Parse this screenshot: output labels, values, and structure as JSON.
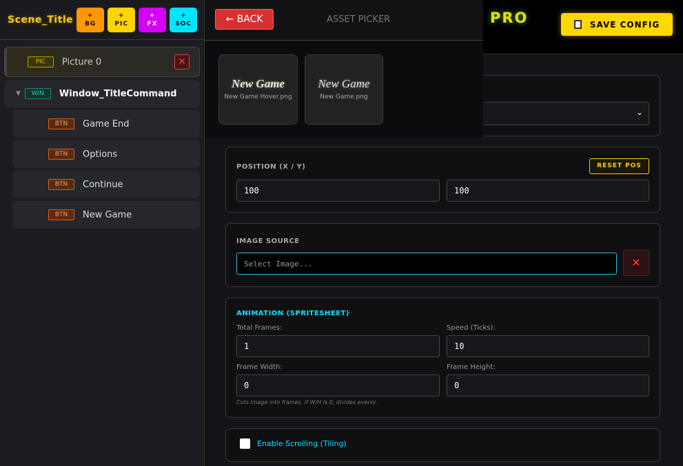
{
  "sidebar": {
    "scene_title": "Scene_Title",
    "add_buttons": [
      {
        "plus": "+",
        "label": "BG",
        "color": "#ff9800"
      },
      {
        "plus": "+",
        "label": "PIC",
        "color": "#ffd500"
      },
      {
        "plus": "+",
        "label": "FX",
        "color": "#d500f9"
      },
      {
        "plus": "+",
        "label": "SOC",
        "color": "#00e5ff"
      }
    ],
    "tree": {
      "picture": {
        "tag": "PIC",
        "label": "Picture 0"
      },
      "window": {
        "tag": "WIN",
        "label": "Window_TitleCommand"
      },
      "buttons": [
        {
          "tag": "BTN",
          "label": "Game End"
        },
        {
          "tag": "BTN",
          "label": "Options"
        },
        {
          "tag": "BTN",
          "label": "Continue"
        },
        {
          "tag": "BTN",
          "label": "New Game"
        }
      ]
    }
  },
  "picker": {
    "back_label": "← BACK",
    "title": "ASSET PICKER",
    "assets": [
      {
        "preview": "New Game",
        "filename": "New Game Hover.png"
      },
      {
        "preview": "New Game",
        "filename": "New Game.png"
      }
    ]
  },
  "header": {
    "pro": "PRO",
    "save_label": "SAVE CONFIG"
  },
  "position": {
    "label": "POSITION (X / Y)",
    "reset_label": "RESET POS",
    "x": "100",
    "y": "100"
  },
  "image_source": {
    "label": "IMAGE SOURCE",
    "placeholder": "Select Image..."
  },
  "animation": {
    "label": "ANIMATION (SPRITESHEET)",
    "total_frames_label": "Total Frames:",
    "total_frames": "1",
    "speed_label": "Speed (Ticks):",
    "speed": "10",
    "frame_width_label": "Frame Width:",
    "frame_width": "0",
    "frame_height_label": "Frame Height:",
    "frame_height": "0",
    "hint": "Cuts image into frames. If W/H is 0, divides evenly."
  },
  "scrolling": {
    "label": "Enable Scrolling (Tiling)",
    "checked": false
  }
}
